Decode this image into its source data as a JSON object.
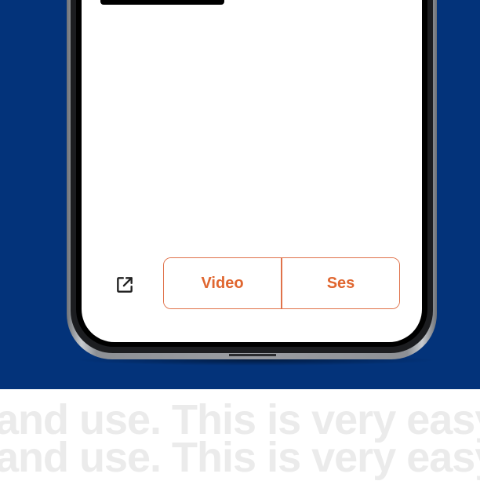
{
  "colors": {
    "hero_background": "#03337a",
    "accent": "#e0662f",
    "ghost_text": "#ebebeb"
  },
  "toolbar": {
    "open_icon": "open-in-new-icon",
    "segments": [
      {
        "label": "Video"
      },
      {
        "label": "Ses"
      }
    ]
  },
  "caption": {
    "line1": "and use. This is very easy",
    "line2": "and use. This is very easy"
  }
}
